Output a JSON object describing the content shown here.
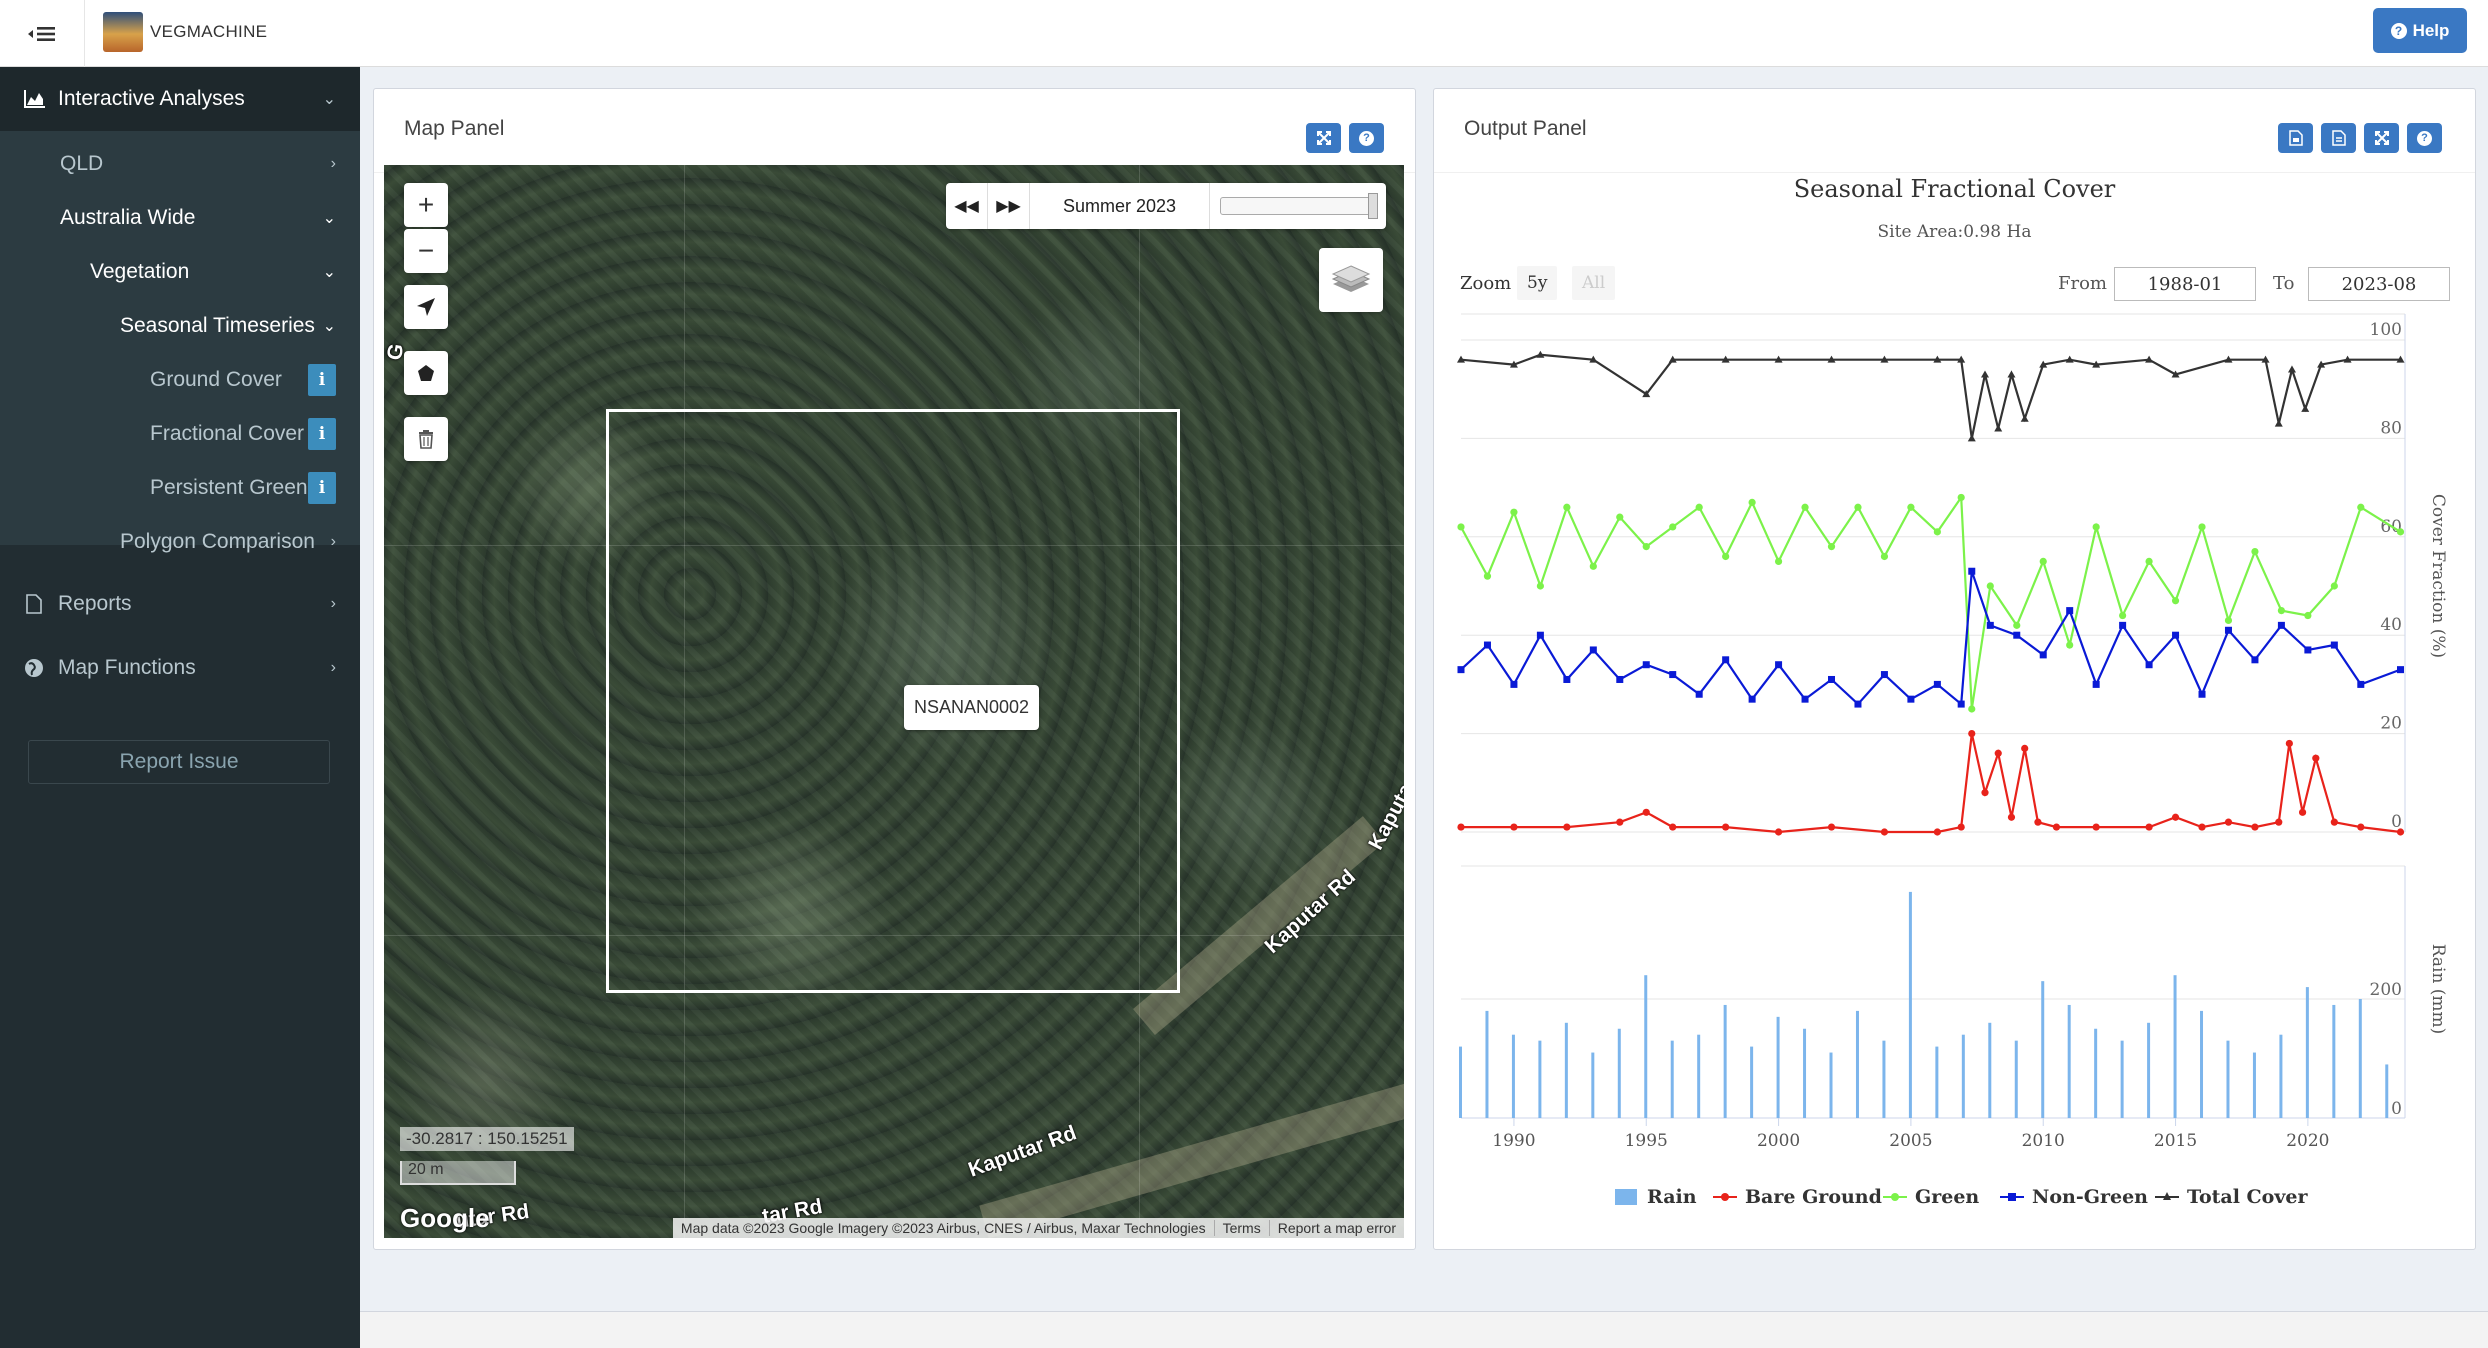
{
  "app": {
    "name": "VEGMACHINE",
    "help_label": "Help"
  },
  "sidebar": {
    "interactive_analyses": "Interactive Analyses",
    "qld": "QLD",
    "australia_wide": "Australia Wide",
    "vegetation": "Vegetation",
    "seasonal_timeseries": "Seasonal Timeseries",
    "ground_cover": "Ground Cover",
    "fractional_cover": "Fractional Cover",
    "persistent_green": "Persistent Green",
    "polygon_comparison": "Polygon Comparison",
    "reports": "Reports",
    "map_functions": "Map Functions",
    "report_issue": "Report Issue",
    "info_glyph": "i"
  },
  "map_panel": {
    "title": "Map Panel",
    "season_label": "Summer 2023",
    "site_label": "NSANAN0002",
    "coords": "-30.2817 : 150.15251",
    "scale": "20 m",
    "road_label": "Kaputar Rd",
    "road_label_partial_a": "Kaputa",
    "road_label_partial_b": "utar Rd",
    "road_label_partial_c": "tar Rd",
    "road_label_partial_d": "G",
    "google": "Google",
    "attribution": "Map data ©2023 Google Imagery ©2023 Airbus, CNES / Airbus, Maxar Technologies",
    "terms": "Terms",
    "report_error": "Report a map error"
  },
  "output_panel": {
    "title": "Output Panel",
    "zoom_label": "Zoom",
    "zoom_5y": "5y",
    "zoom_all": "All",
    "from_label": "From",
    "from_value": "1988-01",
    "to_label": "To",
    "to_value": "2023-08"
  },
  "colors": {
    "rain": "#7cb5ec",
    "bare_ground": "#e8231b",
    "green": "#7cf24a",
    "non_green": "#0a1ad6",
    "total_cover": "#333333",
    "button": "#3a78c3",
    "sidebar": "#222d32"
  },
  "chart_data": {
    "type": "line",
    "title": "Seasonal Fractional Cover",
    "subtitle": "Site Area:0.98 Ha",
    "ylabel": "Cover Fraction (%)",
    "ylabel_rain": "Rain (mm)",
    "x_ticks": [
      "1990",
      "1995",
      "2000",
      "2005",
      "2010",
      "2015",
      "2020"
    ],
    "y_ticks_cover": [
      "0",
      "20",
      "40",
      "60",
      "80",
      "100"
    ],
    "y_ticks_rain": [
      "0",
      "200"
    ],
    "xlim": [
      1988.0,
      2023.67
    ],
    "ylim": [
      0,
      100
    ],
    "legend": [
      "Rain",
      "Bare Ground",
      "Green",
      "Non-Green",
      "Total Cover"
    ],
    "legend_position": "bottom",
    "series": [
      {
        "name": "Total Cover",
        "x": [
          1988,
          1990,
          1991,
          1993,
          1995,
          1996,
          1998,
          2000,
          2002,
          2004,
          2006,
          2006.9,
          2007.3,
          2007.8,
          2008.3,
          2008.8,
          2009.3,
          2010,
          2011,
          2012,
          2014,
          2015,
          2017,
          2018.4,
          2018.9,
          2019.4,
          2019.9,
          2020.5,
          2021.5,
          2023.5
        ],
        "values": [
          96,
          95,
          97,
          96,
          89,
          96,
          96,
          96,
          96,
          96,
          96,
          96,
          80,
          93,
          82,
          93,
          84,
          95,
          96,
          95,
          96,
          93,
          96,
          96,
          83,
          94,
          86,
          95,
          96,
          96
        ]
      },
      {
        "name": "Green",
        "x": [
          1988,
          1989,
          1990,
          1991,
          1992,
          1993,
          1994,
          1995,
          1996,
          1997,
          1998,
          1999,
          2000,
          2001,
          2002,
          2003,
          2004,
          2005,
          2006,
          2006.9,
          2007.3,
          2008,
          2009,
          2010,
          2011,
          2012,
          2013,
          2014,
          2015,
          2016,
          2017,
          2018,
          2019,
          2020,
          2021,
          2022,
          2023.5
        ],
        "values": [
          62,
          52,
          65,
          50,
          66,
          54,
          64,
          58,
          62,
          66,
          56,
          67,
          55,
          66,
          58,
          66,
          56,
          66,
          61,
          68,
          25,
          50,
          42,
          55,
          38,
          62,
          44,
          55,
          47,
          62,
          43,
          57,
          45,
          44,
          50,
          66,
          61
        ]
      },
      {
        "name": "Non-Green",
        "x": [
          1988,
          1989,
          1990,
          1991,
          1992,
          1993,
          1994,
          1995,
          1996,
          1997,
          1998,
          1999,
          2000,
          2001,
          2002,
          2003,
          2004,
          2005,
          2006,
          2006.9,
          2007.3,
          2008,
          2009,
          2010,
          2011,
          2012,
          2013,
          2014,
          2015,
          2016,
          2017,
          2018,
          2019,
          2020,
          2021,
          2022,
          2023.5
        ],
        "values": [
          33,
          38,
          30,
          40,
          31,
          37,
          31,
          34,
          32,
          28,
          35,
          27,
          34,
          27,
          31,
          26,
          32,
          27,
          30,
          26,
          53,
          42,
          40,
          36,
          45,
          30,
          42,
          34,
          40,
          28,
          41,
          35,
          42,
          37,
          38,
          30,
          33
        ]
      },
      {
        "name": "Bare Ground",
        "x": [
          1988,
          1990,
          1992,
          1994,
          1995,
          1996,
          1998,
          2000,
          2002,
          2004,
          2006,
          2006.9,
          2007.3,
          2007.8,
          2008.3,
          2008.8,
          2009.3,
          2009.8,
          2010.5,
          2012,
          2014,
          2015,
          2016,
          2017,
          2018,
          2018.9,
          2019.3,
          2019.8,
          2020.3,
          2021,
          2022,
          2023.5
        ],
        "values": [
          1,
          1,
          1,
          2,
          4,
          1,
          1,
          0,
          1,
          0,
          0,
          1,
          20,
          8,
          16,
          3,
          17,
          2,
          1,
          1,
          1,
          3,
          1,
          2,
          1,
          2,
          18,
          4,
          15,
          2,
          1,
          0
        ]
      },
      {
        "name": "Rain",
        "type": "bar",
        "x": [
          1988,
          1989,
          1990,
          1991,
          1992,
          1993,
          1994,
          1995,
          1996,
          1997,
          1998,
          1999,
          2000,
          2001,
          2002,
          2003,
          2004,
          2005,
          2006,
          2007,
          2008,
          2009,
          2010,
          2011,
          2012,
          2013,
          2014,
          2015,
          2016,
          2017,
          2018,
          2019,
          2020,
          2021,
          2022,
          2023
        ],
        "values": [
          120,
          180,
          140,
          130,
          160,
          110,
          150,
          240,
          130,
          140,
          190,
          120,
          170,
          150,
          110,
          180,
          130,
          380,
          120,
          140,
          160,
          130,
          230,
          190,
          150,
          130,
          160,
          240,
          180,
          130,
          110,
          140,
          220,
          190,
          200,
          90
        ]
      }
    ]
  }
}
